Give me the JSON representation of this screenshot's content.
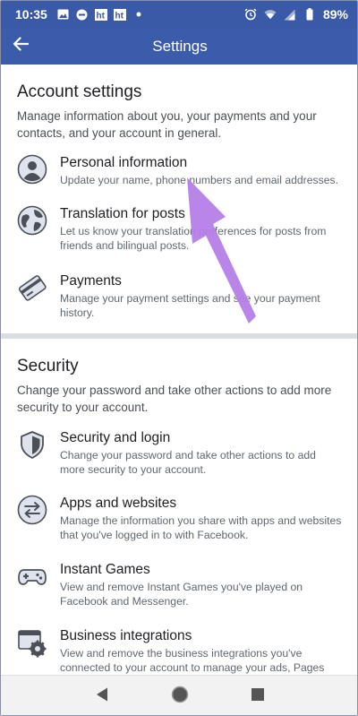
{
  "status_bar": {
    "time": "10:35",
    "battery": "89%",
    "icons_left": [
      "image-icon",
      "blocked-icon",
      "ht-app-icon",
      "ht-app-icon",
      "dot-icon"
    ],
    "icons_right": [
      "alarm-icon",
      "wifi-icon",
      "signal-icon",
      "battery-icon"
    ]
  },
  "app_bar": {
    "title": "Settings",
    "background": "#3b5bab"
  },
  "account_settings": {
    "title": "Account settings",
    "description": "Manage information about you, your payments and your contacts, and your account in general.",
    "items": [
      {
        "icon": "personal-info-icon",
        "title": "Personal information",
        "subtitle": "Update your name, phone numbers and email addresses."
      },
      {
        "icon": "globe-icon",
        "title": "Translation for posts",
        "subtitle": "Let us know your translation preferences for posts from friends and bilingual posts."
      },
      {
        "icon": "card-icon",
        "title": "Payments",
        "subtitle": "Manage your payment settings and see your payment history."
      }
    ]
  },
  "security": {
    "title": "Security",
    "description": "Change your password and take other actions to add more security to your account.",
    "items": [
      {
        "icon": "shield-icon",
        "title": "Security and login",
        "subtitle": "Change your password and take other actions to add more security to your account."
      },
      {
        "icon": "swap-icon",
        "title": "Apps and websites",
        "subtitle": "Manage the information you share with apps and websites that you've logged in to with Facebook."
      },
      {
        "icon": "gamepad-icon",
        "title": "Instant Games",
        "subtitle": "View and remove Instant Games you've played on Facebook and Messenger."
      },
      {
        "icon": "business-gear-icon",
        "title": "Business integrations",
        "subtitle": "View and remove the business integrations you've connected to your account to manage your ads, Pages and other business information."
      }
    ]
  },
  "nav_bar": {
    "buttons": [
      "back-triangle-icon",
      "home-circle-icon",
      "recents-square-icon"
    ]
  },
  "colors": {
    "brand_blue": "#3b5bab",
    "annotation_arrow": "#b57ee8"
  }
}
